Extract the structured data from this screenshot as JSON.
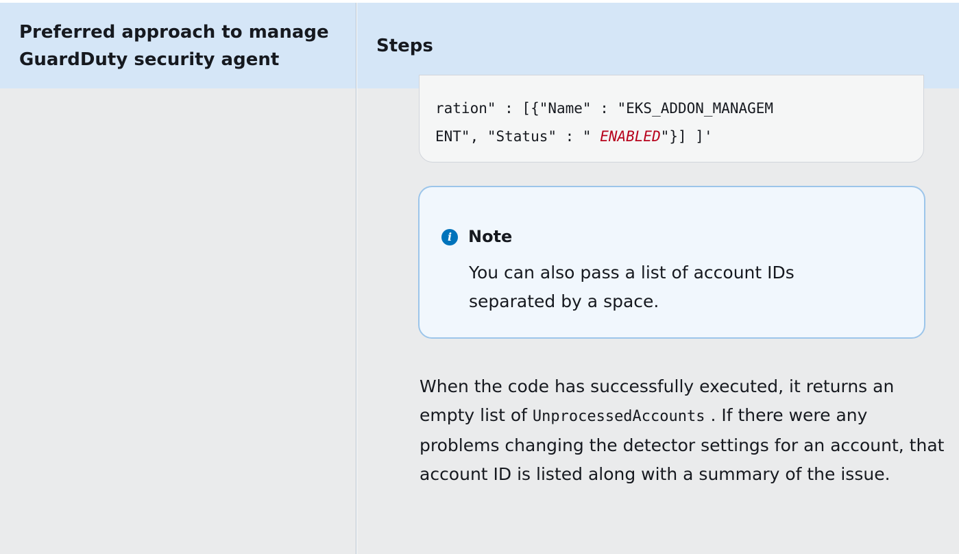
{
  "table": {
    "headers": {
      "approach": [
        "Preferred approach to manage",
        "GuardDuty security agent"
      ],
      "steps": "Steps"
    }
  },
  "code_block": {
    "line1": "ration\" : [{\"Name\" : \"EKS_ADDON_MANAGEM",
    "line2_prefix": "ENT\", \"Status\" : \" ",
    "line2_highlight": "ENABLED",
    "line2_suffix": "\"}] ]'"
  },
  "note": {
    "icon": "info-icon",
    "title": "Note",
    "text": "You can also pass a list of account IDs separated by a space."
  },
  "paragraph": {
    "before_code": "When the code has successfully executed, it returns an empty list of ",
    "code": "UnprocessedAccounts",
    "after_code": "   . If there were any problems changing the detector settings for an account, that account ID is listed along with a summary of the issue."
  },
  "colors": {
    "header_bg": "#d5e6f7",
    "body_bg": "#eaebec",
    "note_border": "#9cc5ea",
    "note_bg": "#f1f7fd",
    "info_icon": "#0073bb",
    "highlight_red": "#b7021c"
  }
}
